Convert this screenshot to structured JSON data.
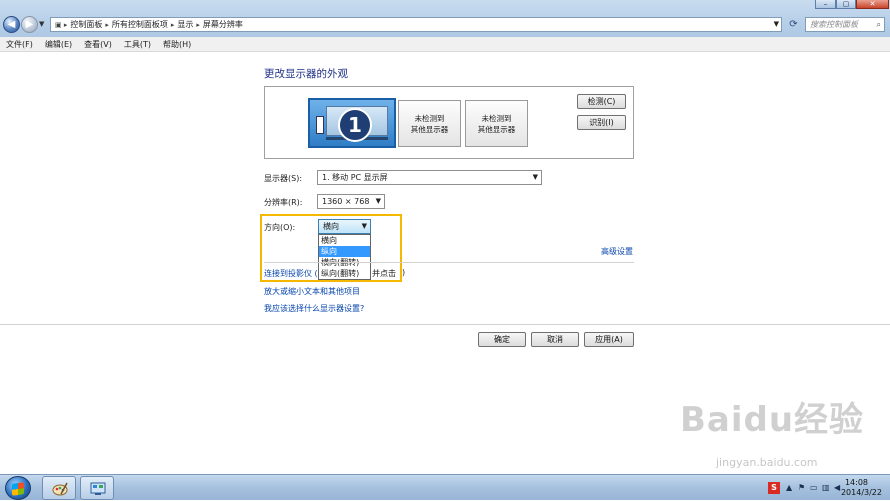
{
  "address": {
    "segments": [
      "控制面板",
      "所有控制面板项",
      "显示",
      "屏幕分辨率"
    ]
  },
  "search": {
    "placeholder": "搜索控制面板"
  },
  "menu": [
    "文件(F)",
    "编辑(E)",
    "查看(V)",
    "工具(T)",
    "帮助(H)"
  ],
  "page_title": "更改显示器的外观",
  "monitors": {
    "primary_number": "1",
    "undetected_1_line1": "未检测到",
    "undetected_1_line2": "其他显示器",
    "undetected_2_line1": "未检测到",
    "undetected_2_line2": "其他显示器"
  },
  "buttons": {
    "detect": "检测(C)",
    "identify": "识别(I)",
    "ok": "确定",
    "cancel": "取消",
    "apply": "应用(A)"
  },
  "fields": {
    "display_label": "显示器(S):",
    "display_value": "1. 移动 PC 显示屏",
    "resolution_label": "分辨率(R):",
    "resolution_value": "1360 × 768",
    "orientation_label": "方向(O):",
    "orientation_value": "横向"
  },
  "orientation_options": [
    "横向",
    "纵向",
    "横向(翻转)",
    "纵向(翻转)"
  ],
  "orientation_selected_index": 1,
  "links": {
    "advanced": "高级设置",
    "projector": "连接到投影仪 (",
    "projector_tail": "并点击",
    "projector_close": ")",
    "enlarge": "放大或缩小文本和其他项目",
    "which": "我应该选择什么显示器设置?"
  },
  "taskbar": {
    "time": "14:08",
    "date": "2014/3/22",
    "ime": "S"
  },
  "watermark": {
    "logo": "Baidu经验",
    "url": "jingyan.baidu.com"
  },
  "colors": {
    "title_blue": "#1e3287",
    "link_blue": "#0645ad",
    "highlight_box": "#f5b800",
    "selected": "#3399ff"
  }
}
